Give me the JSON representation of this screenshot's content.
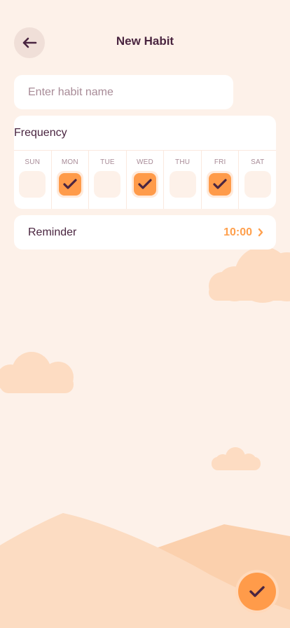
{
  "header": {
    "title": "New Habit",
    "back_icon": "arrow-left-icon"
  },
  "habit_name": {
    "value": "",
    "placeholder": "Enter habit name"
  },
  "frequency": {
    "label": "Frequency",
    "days": [
      {
        "label": "SUN",
        "checked": false
      },
      {
        "label": "MON",
        "checked": true
      },
      {
        "label": "TUE",
        "checked": false
      },
      {
        "label": "WED",
        "checked": true
      },
      {
        "label": "THU",
        "checked": false
      },
      {
        "label": "FRI",
        "checked": true
      },
      {
        "label": "SAT",
        "checked": false
      }
    ]
  },
  "reminder": {
    "label": "Reminder",
    "time": "10:00",
    "icon": "chevron-right-icon"
  },
  "fab": {
    "icon": "check-icon"
  },
  "colors": {
    "background": "#fdf1e9",
    "accent": "#ff9b4a",
    "text": "#4a2540",
    "muted": "#a88b97"
  }
}
